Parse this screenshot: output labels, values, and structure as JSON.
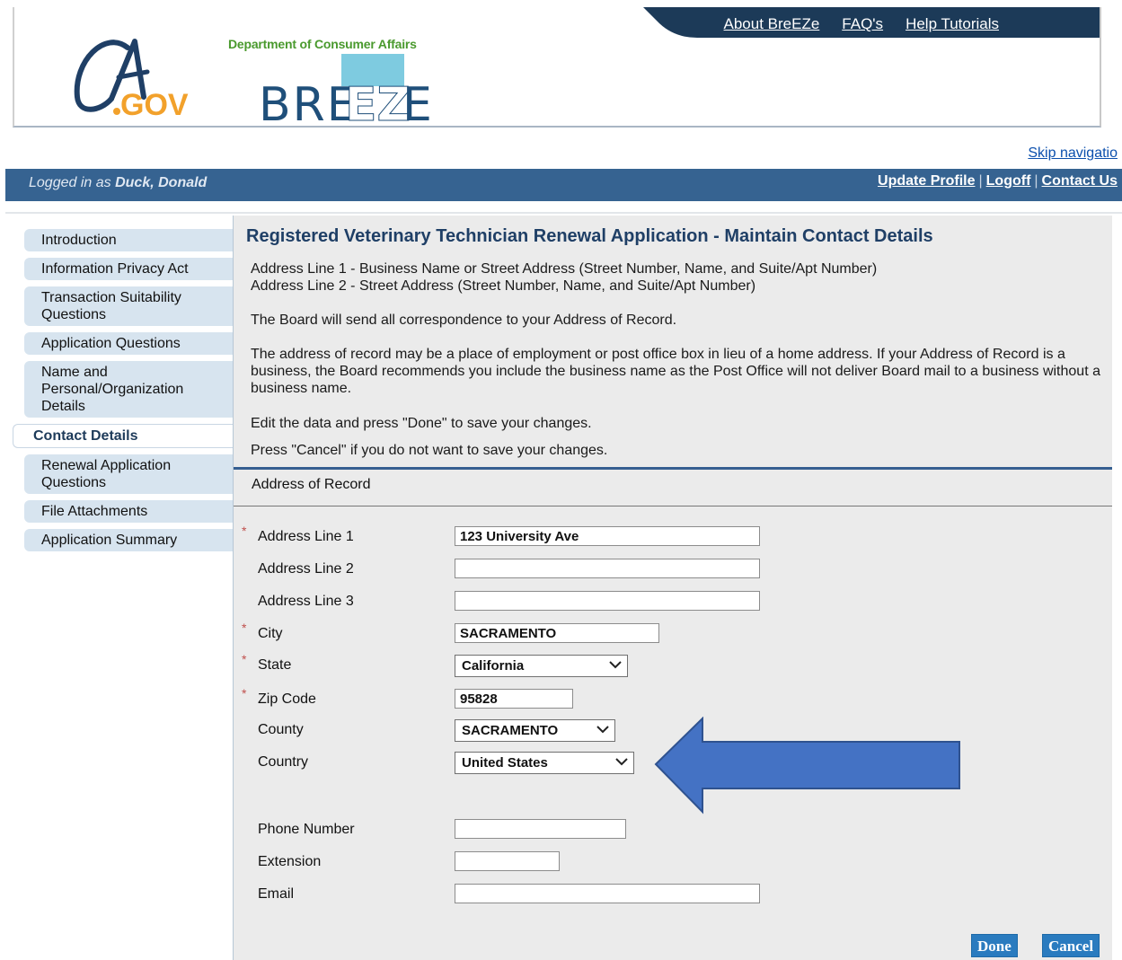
{
  "header": {
    "dept_name": "Department of Consumer Affairs",
    "logo_text": "CA.GOV",
    "brand_text": "BREEZE",
    "links": [
      "About BreEZe",
      "FAQ's",
      "Help Tutorials"
    ]
  },
  "skip_navigation": "Skip navigatio",
  "login_bar": {
    "logged_prefix": "Logged in as",
    "user": "Duck, Donald",
    "links": [
      "Update Profile",
      "Logoff",
      "Contact Us"
    ]
  },
  "sidebar": {
    "items": [
      {
        "label": "Introduction",
        "active": false
      },
      {
        "label": "Information Privacy Act",
        "active": false
      },
      {
        "label": "Transaction Suitability Questions",
        "active": false
      },
      {
        "label": "Application Questions",
        "active": false
      },
      {
        "label": "Name and Personal/Organization Details",
        "active": false
      },
      {
        "label": "Contact Details",
        "active": true
      },
      {
        "label": "Renewal Application Questions",
        "active": false
      },
      {
        "label": "File Attachments",
        "active": false
      },
      {
        "label": "Application Summary",
        "active": false
      }
    ]
  },
  "main": {
    "title": "Registered Veterinary Technician Renewal Application - Maintain Contact Details",
    "instr_line1": "Address Line 1 - Business Name or Street Address (Street Number, Name, and Suite/Apt Number)",
    "instr_line2": "Address Line 2 - Street Address (Street Number, Name, and Suite/Apt Number)",
    "instr_correspondence": "The Board will send all correspondence to your Address of Record.",
    "instr_address_record": "The address of record may be a place of employment or post office box in lieu of a home address. If your Address of Record is a business, the Board recommends you include the business name as the Post Office will not deliver Board mail to a business without a business name.",
    "instr_edit": "Edit the data and press \"Done\" to save your changes.",
    "instr_cancel": "Press \"Cancel\" if you do not want to save your changes.",
    "section_title": "Address of Record",
    "required_mark": "*",
    "fields": {
      "address1": {
        "label": "Address Line 1",
        "value": "123 University Ave",
        "required": true
      },
      "address2": {
        "label": "Address Line 2",
        "value": "",
        "required": false
      },
      "address3": {
        "label": "Address Line 3",
        "value": "",
        "required": false
      },
      "city": {
        "label": "City",
        "value": "SACRAMENTO",
        "required": true
      },
      "state": {
        "label": "State",
        "value": "California",
        "required": true
      },
      "zip": {
        "label": "Zip Code",
        "value": "95828",
        "required": true
      },
      "county": {
        "label": "County",
        "value": "SACRAMENTO",
        "required": false
      },
      "country": {
        "label": "Country",
        "value": "United States",
        "required": false
      },
      "phone": {
        "label": "Phone Number",
        "value": "",
        "required": false
      },
      "extension": {
        "label": "Extension",
        "value": "",
        "required": false
      },
      "email": {
        "label": "Email",
        "value": "",
        "required": false
      }
    },
    "done_label": "Done",
    "cancel_label": "Cancel"
  },
  "colors": {
    "login_bar": "#366391",
    "header_tab": "#1c3a58",
    "title": "#1f3f66",
    "button": "#2a7bbf",
    "arrow": "#4472c4",
    "required": "#c0504d"
  }
}
